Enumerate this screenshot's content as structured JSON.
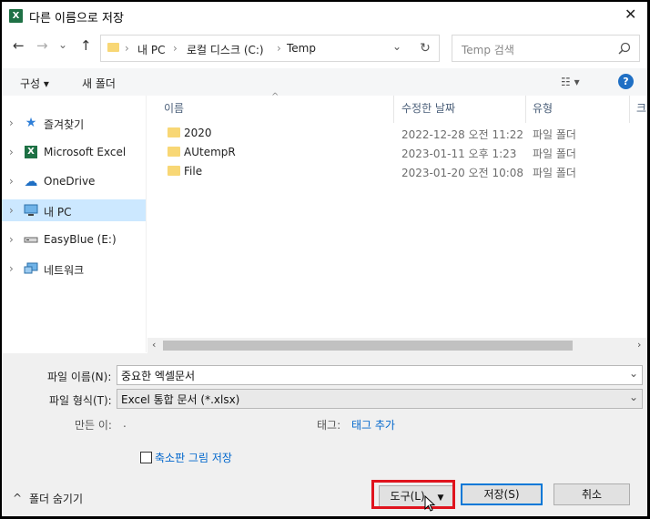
{
  "window": {
    "title": "다른 이름으로 저장",
    "app_icon": "excel-icon",
    "close": "✕"
  },
  "nav": {
    "back": "←",
    "forward": "→",
    "recent": "⌄",
    "up": "↑"
  },
  "address": {
    "crumbs": [
      "내 PC",
      "로컬 디스크 (C:)",
      "Temp"
    ],
    "sep": "›",
    "dropdown": "⌄",
    "refresh": "↻"
  },
  "search": {
    "placeholder": "Temp 검색"
  },
  "toolbar": {
    "organize": "구성 ▾",
    "new_folder": "새 폴더",
    "view": "☷ ▾",
    "help": "?"
  },
  "sidebar": {
    "items": [
      {
        "label": "즐겨찾기",
        "icon": "star-icon"
      },
      {
        "label": "Microsoft Excel",
        "icon": "excel-icon"
      },
      {
        "label": "OneDrive",
        "icon": "cloud-icon"
      },
      {
        "label": "내 PC",
        "icon": "computer-icon",
        "selected": true
      },
      {
        "label": "EasyBlue (E:)",
        "icon": "drive-icon"
      },
      {
        "label": "네트워크",
        "icon": "network-icon"
      }
    ]
  },
  "columns": {
    "name": "이름",
    "date": "수정한 날짜",
    "type": "유형",
    "size": "크"
  },
  "files": [
    {
      "name": "2020",
      "date": "2022-12-28 오전 11:22",
      "type": "파일 폴더"
    },
    {
      "name": "AUtempR",
      "date": "2023-01-11 오후 1:23",
      "type": "파일 폴더"
    },
    {
      "name": "File",
      "date": "2023-01-20 오전 10:08",
      "type": "파일 폴더"
    }
  ],
  "form": {
    "filename_label": "파일 이름(N):",
    "filename_value": "중요한 엑셀문서",
    "filetype_label": "파일 형식(T):",
    "filetype_value": "Excel 통합 문서 (*.xlsx)",
    "author_label": "만든 이:",
    "author_value": ".",
    "tags_label": "태그:",
    "tags_value": "태그 추가",
    "thumbnail_label": "축소판 그림 저장"
  },
  "footer": {
    "hide_folders": "폴더 숨기기",
    "tools_button": "도구(L)",
    "save_button": "저장(S)",
    "cancel_button": "취소"
  },
  "colors": {
    "accent": "#0078d7",
    "highlight": "#e0141e",
    "selected": "#cce8ff",
    "folder": "#f8d775"
  }
}
